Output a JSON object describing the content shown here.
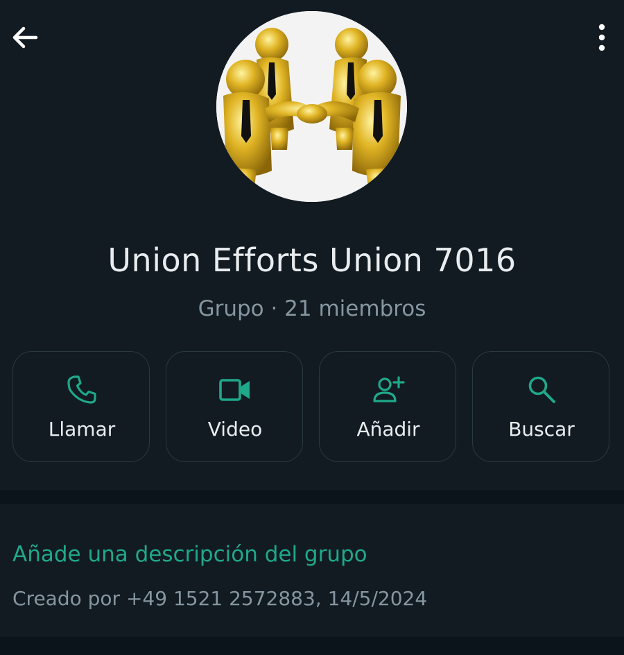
{
  "header": {
    "back_icon": "arrow-left-icon",
    "menu_icon": "more-vert-icon"
  },
  "group": {
    "name": "Union Efforts Union 7016",
    "meta": "Grupo · 21 miembros",
    "avatar": "golden-figures-teamwork-image"
  },
  "actions": [
    {
      "label": "Llamar",
      "icon": "phone-icon"
    },
    {
      "label": "Video",
      "icon": "video-camera-icon"
    },
    {
      "label": "Añadir",
      "icon": "add-person-icon"
    },
    {
      "label": "Buscar",
      "icon": "search-icon"
    }
  ],
  "description": {
    "add_link": "Añade una descripción del grupo",
    "created_by": "Creado por +49 1521 2572883, 14/5/2024"
  },
  "colors": {
    "background": "#121b22",
    "accent": "#1fa88a",
    "text_primary": "#e9edef",
    "text_secondary": "#8696a0"
  }
}
